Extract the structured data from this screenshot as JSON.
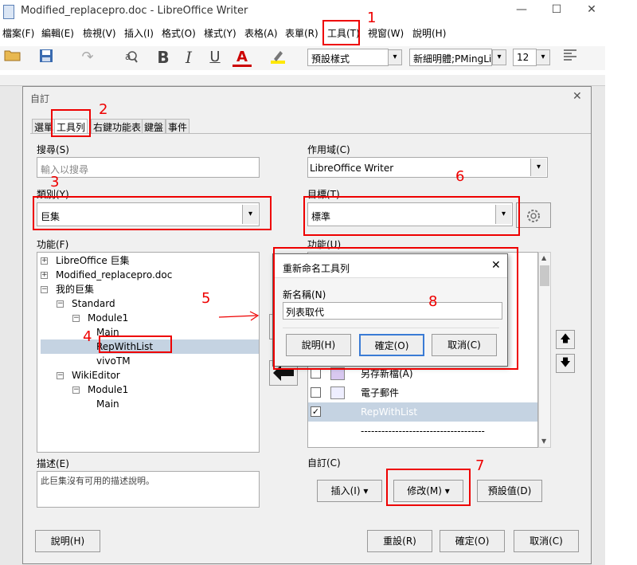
{
  "window": {
    "title": "Modified_replacepro.doc - LibreOffice Writer",
    "min": "—",
    "max": "☐",
    "close": "✕"
  },
  "menu": [
    "檔案(F)",
    "編輯(E)",
    "檢視(V)",
    "插入(I)",
    "格式(O)",
    "樣式(Y)",
    "表格(A)",
    "表單(R)",
    "工具(T)",
    "視窗(W)",
    "說明(H)"
  ],
  "toolbar": {
    "style_combo": "預設樣式",
    "font_combo": "新細明體;PMingLiU",
    "size_combo": "12",
    "bold": "B",
    "italic": "I",
    "underline": "U",
    "font_color": "A"
  },
  "dialog": {
    "title": "自訂",
    "tabs": [
      "選單",
      "工具列",
      "右鍵功能表",
      "鍵盤",
      "事件"
    ],
    "search_label": "搜尋(S)",
    "search_placeholder": "輸入以搜尋",
    "category_label": "類別(Y)",
    "category_value": "巨集",
    "function_label": "功能(F)",
    "tree": [
      {
        "label": "LibreOffice 巨集",
        "indent": 0,
        "exp": "+"
      },
      {
        "label": "Modified_replacepro.doc",
        "indent": 0,
        "exp": "+"
      },
      {
        "label": "我的巨集",
        "indent": 0,
        "exp": "−"
      },
      {
        "label": "Standard",
        "indent": 1,
        "exp": "−"
      },
      {
        "label": "Module1",
        "indent": 2,
        "exp": "−"
      },
      {
        "label": "Main",
        "indent": 3,
        "exp": ""
      },
      {
        "label": "RepWithList",
        "indent": 3,
        "exp": "",
        "selected": true
      },
      {
        "label": "vivoTM",
        "indent": 3,
        "exp": ""
      },
      {
        "label": "WikiEditor",
        "indent": 1,
        "exp": "−"
      },
      {
        "label": "Module1",
        "indent": 2,
        "exp": "−"
      },
      {
        "label": "Main",
        "indent": 3,
        "exp": ""
      }
    ],
    "description_label": "描述(E)",
    "description_text": "此巨集沒有可用的描述說明。",
    "scope_label": "作用域(C)",
    "scope_value": "LibreOffice Writer",
    "target_label": "目標(T)",
    "target_value": "標準",
    "right_function_label": "功能(U)",
    "right_list": [
      {
        "label": "另存新檔(A)",
        "checked": false,
        "icon": "save-as-icon"
      },
      {
        "label": "電子郵件",
        "checked": false,
        "icon": "email-icon"
      },
      {
        "label": "RepWithList",
        "checked": true,
        "icon": "",
        "selected": true
      },
      {
        "label": "------------------------------------",
        "checked": null,
        "icon": ""
      }
    ],
    "customize_label": "自訂(C)",
    "insert_button": "插入(I)",
    "modify_button": "修改(M)",
    "default_button": "預設值(D)",
    "help_button": "說明(H)",
    "reset_button": "重設(R)",
    "ok_button": "確定(O)",
    "cancel_button": "取消(C)"
  },
  "rename_dialog": {
    "title": "重新命名工具列",
    "name_label": "新名稱(N)",
    "name_value": "列表取代",
    "help_button": "說明(H)",
    "ok_button": "確定(O)",
    "cancel_button": "取消(C)"
  },
  "annotations": [
    "1",
    "2",
    "3",
    "4",
    "5",
    "6",
    "7",
    "8"
  ],
  "colors": {
    "annotation": "#e00000",
    "selection": "#c5d3e2"
  }
}
